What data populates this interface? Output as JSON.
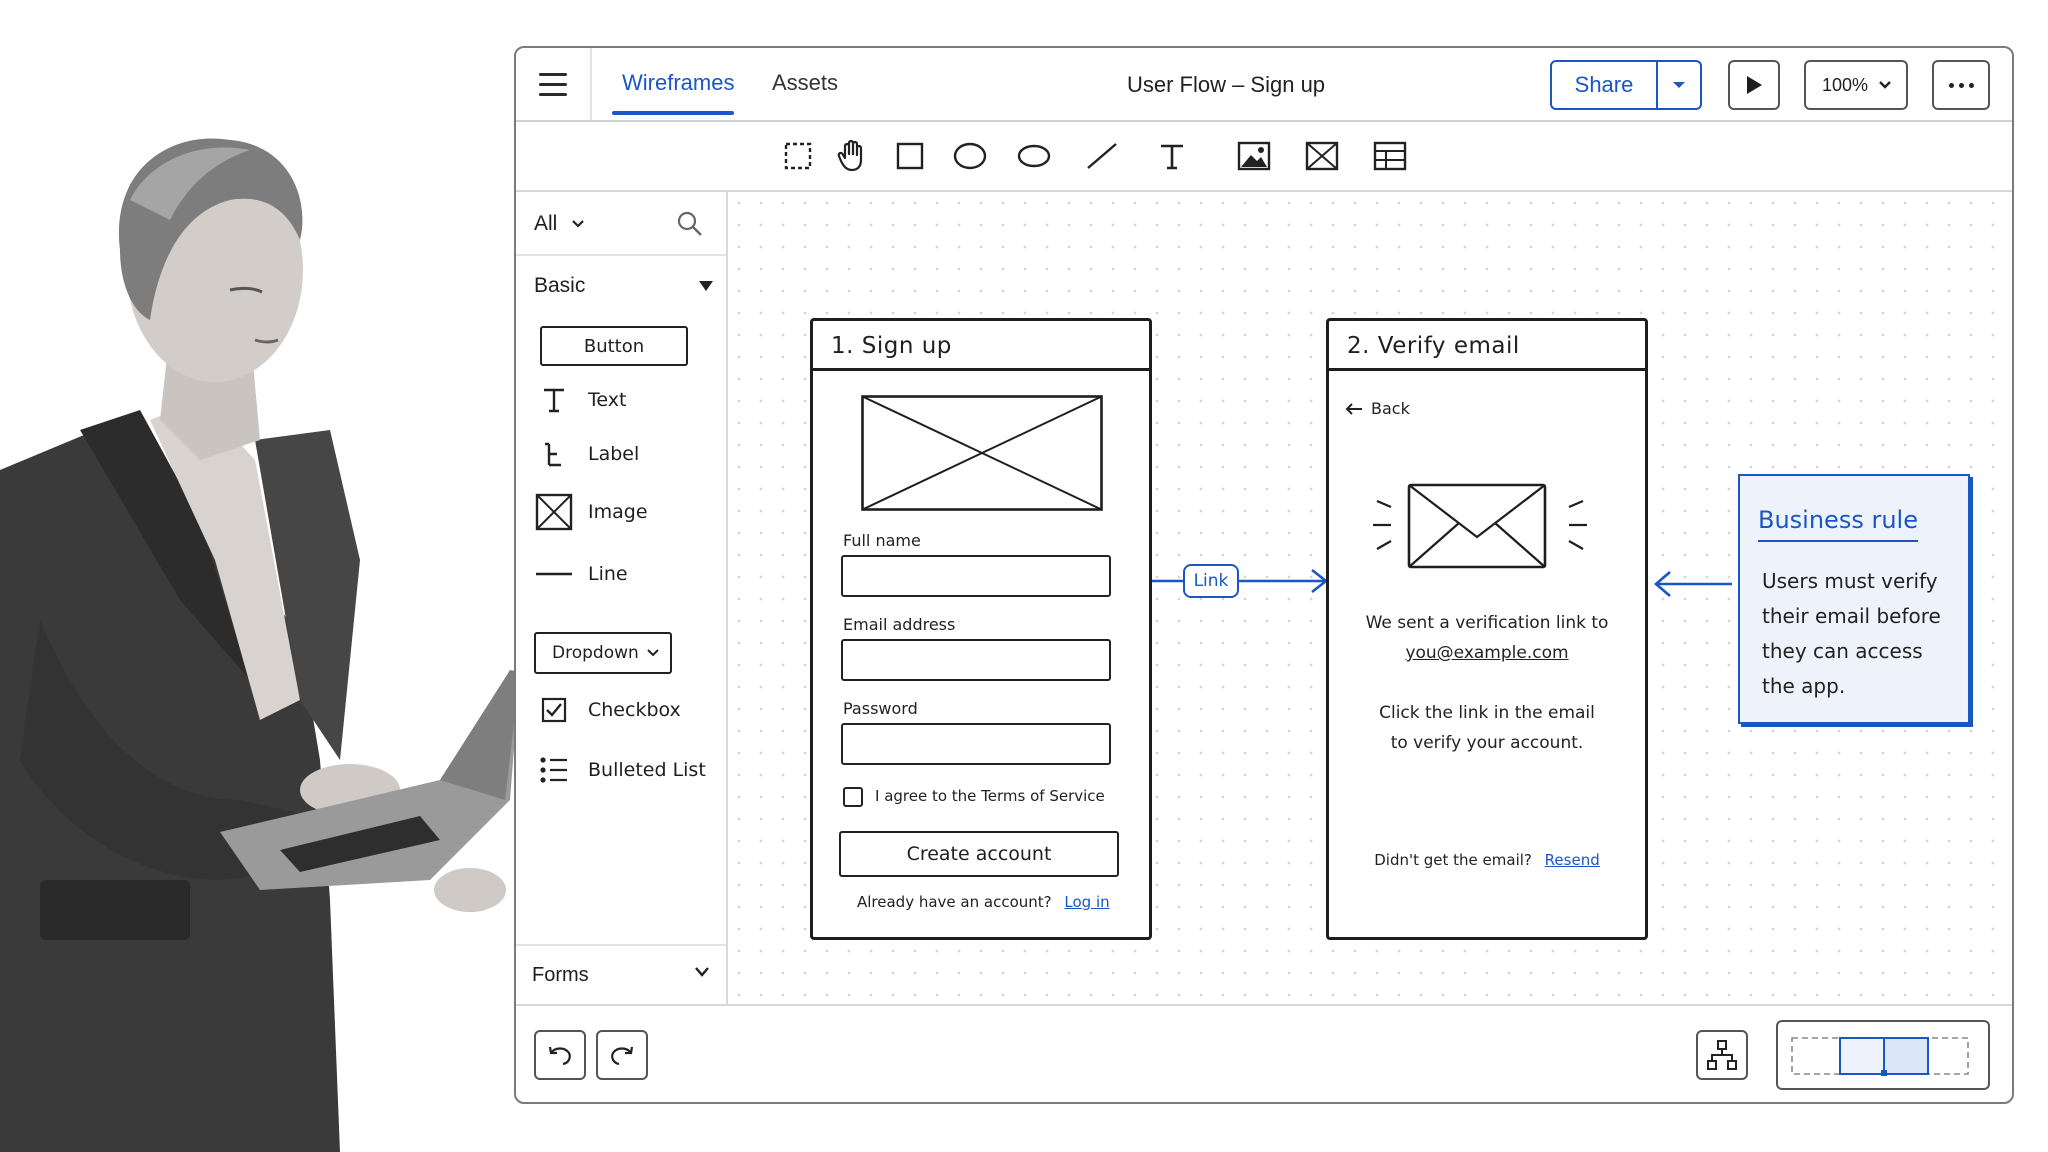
{
  "colors": {
    "accent": "#1a56c4",
    "ink": "#1e1e1e",
    "card_bg": "#eef3fb"
  },
  "header": {
    "tabs": [
      {
        "label": "Wireframes",
        "active": true
      },
      {
        "label": "Assets",
        "active": false
      }
    ],
    "title": "User Flow – Sign up",
    "share_label": "Share",
    "zoom": "100%"
  },
  "toolbar": {
    "tools": [
      "marquee-select-icon",
      "hand-icon",
      "rectangle-icon",
      "ellipse-icon",
      "oval-icon",
      "line-icon",
      "text-icon",
      "image-icon",
      "placeholder-icon",
      "table-icon"
    ]
  },
  "sidebar": {
    "filter": "All",
    "section": "Basic",
    "components": {
      "button": "Button",
      "text": "Text",
      "label": "Label",
      "image": "Image",
      "line": "Line",
      "dropdown": "Dropdown",
      "checkbox": "Checkbox",
      "bulleted_list": "Bulleted List"
    },
    "footer_section": "Forms"
  },
  "canvas": {
    "frame1": {
      "title": "1. Sign up",
      "full_name_label": "Full name",
      "email_label": "Email address",
      "password_label": "Password",
      "terms_label": "I agree to the Terms of Service",
      "create_button": "Create account",
      "login_prompt": "Already have an account?",
      "login_link": "Log in"
    },
    "link_label": "Link",
    "frame2": {
      "title": "2. Verify email",
      "back": "Back",
      "sent_text": "We sent a verification link to",
      "email": "you@example.com",
      "instruction_line1": "Click the link in the email",
      "instruction_line2": "to verify your account.",
      "resend_prompt": "Didn't get the email?",
      "resend_link": "Resend"
    },
    "business_rule": {
      "title": "Business rule",
      "lines": [
        "Users must verify",
        "their email before",
        "they can access",
        "the app."
      ]
    }
  }
}
